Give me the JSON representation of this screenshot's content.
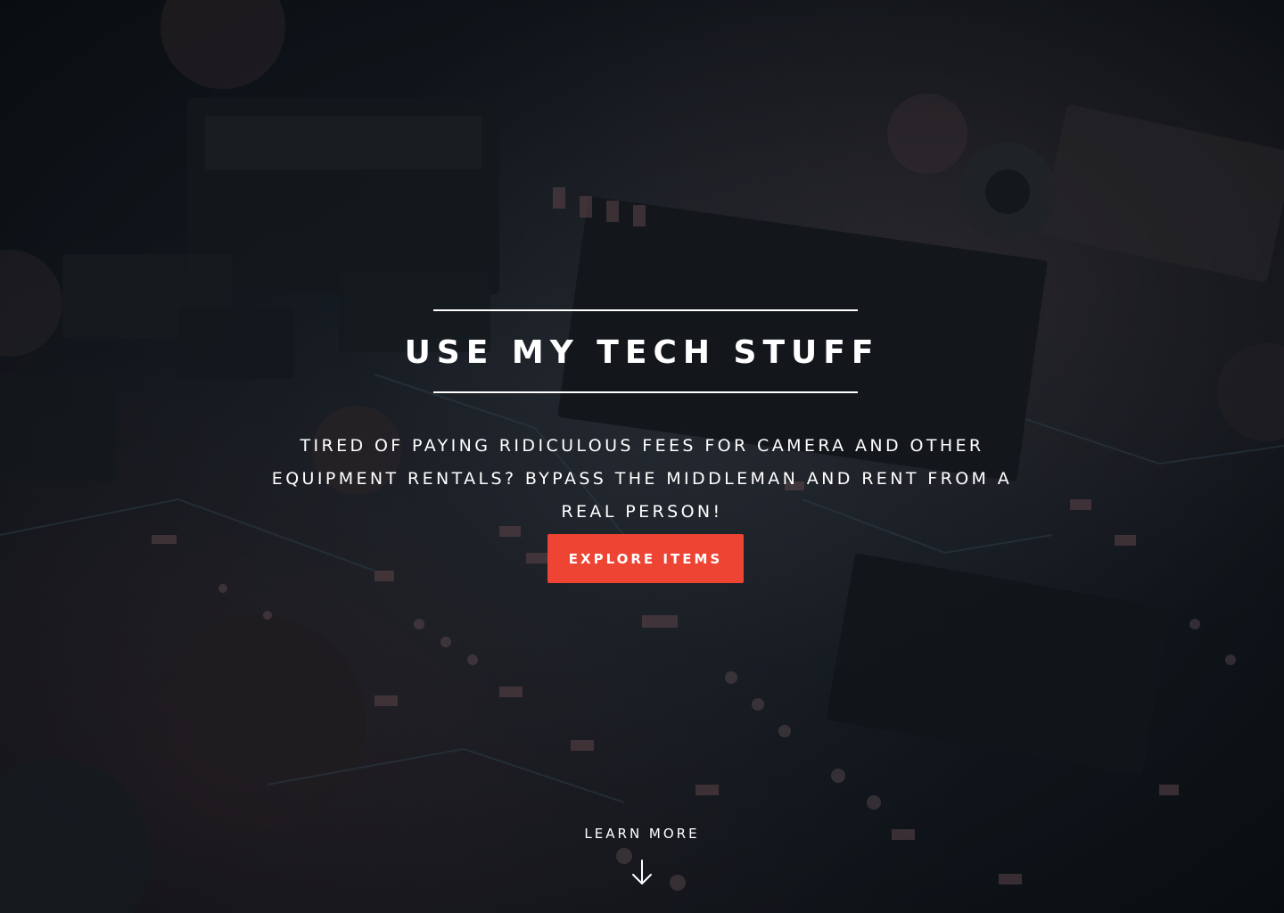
{
  "hero": {
    "title": "USE MY TECH STUFF",
    "tagline": "TIRED OF PAYING RIDICULOUS FEES FOR CAMERA AND OTHER EQUIPMENT RENTALS? BYPASS THE MIDDLEMAN AND RENT FROM A REAL PERSON!",
    "cta_label": "EXPLORE ITEMS",
    "learn_more_label": "LEARN MORE",
    "learn_more_icon": "arrow-down-icon",
    "background_image": "circuit-board-photo"
  },
  "colors": {
    "accent": "#ee4433",
    "text": "#ffffff"
  }
}
